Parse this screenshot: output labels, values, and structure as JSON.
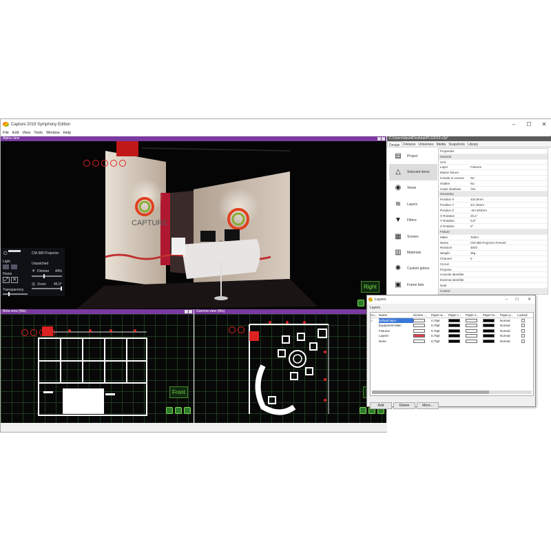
{
  "app_title": "Capture 2019 Symphony Edition",
  "menu": [
    "File",
    "Edit",
    "View",
    "Tools",
    "Window",
    "Help"
  ],
  "views": {
    "alpha": {
      "title": "Alpha view",
      "label": "Right"
    },
    "beta": {
      "title": "Beta view (Mix)",
      "label": "Front"
    },
    "gamma": {
      "title": "Gamma view (Mix)",
      "label": "T"
    }
  },
  "control_panel": {
    "fixture": "CM-380 Projector",
    "status": "Unpatched",
    "light": "Light",
    "home": "Home",
    "dimmer_label": "Dimmer",
    "dimmer_value": "44%",
    "zoom_label": "Zoom",
    "zoom_value": "45.0°",
    "transparency": "Transparency"
  },
  "right_panel": {
    "path": "C:\\Users\\david\\Desktop\\PLS2019.c2p*",
    "tabs": [
      "Design",
      "Fixtures",
      "Universes",
      "Media",
      "Snapshots",
      "Library"
    ],
    "sidebar": [
      {
        "label": "Project",
        "icon": "project-icon"
      },
      {
        "label": "Selected items",
        "icon": "selected-items-icon"
      },
      {
        "label": "Views",
        "icon": "eye-icon"
      },
      {
        "label": "Layers",
        "icon": "layers-icon"
      },
      {
        "label": "Filters",
        "icon": "filter-icon"
      },
      {
        "label": "Scenes",
        "icon": "clapper-icon"
      },
      {
        "label": "Materials",
        "icon": "materials-icon"
      },
      {
        "label": "Custom gobos",
        "icon": "gobo-icon"
      },
      {
        "label": "Frame lists",
        "icon": "frame-list-icon"
      }
    ],
    "properties_title": "Properties",
    "properties": [
      {
        "k": "General",
        "v": "",
        "sec": true
      },
      {
        "k": "Unit",
        "v": ""
      },
      {
        "k": "Layer",
        "v": "Fixtures"
      },
      {
        "k": "Motion fixture",
        "v": ""
      },
      {
        "k": "Include in scenes",
        "v": "No"
      },
      {
        "k": "Hidden",
        "v": "No"
      },
      {
        "k": "Casts shadows",
        "v": "Yes"
      },
      {
        "k": "Geometry",
        "v": "",
        "sec": true
      },
      {
        "k": "Position X",
        "v": "420,9mm"
      },
      {
        "k": "Position Y",
        "v": "4m 18mm"
      },
      {
        "k": "Position Z",
        "v": "-4m 503mm"
      },
      {
        "k": "X Rotation",
        "v": "20,1°"
      },
      {
        "k": "Y Rotation",
        "v": "0,0°"
      },
      {
        "k": "Z Rotation",
        "v": "0°"
      },
      {
        "k": "Fixture",
        "v": "",
        "sec": true
      },
      {
        "k": "Make",
        "v": "Telem"
      },
      {
        "k": "Name",
        "v": "CM-380 Projector Fresnel"
      },
      {
        "k": "Revision",
        "v": "3003"
      },
      {
        "k": "Weight",
        "v": "3kg"
      },
      {
        "k": "Channel",
        "v": "0"
      },
      {
        "k": "Circuit",
        "v": ""
      },
      {
        "k": "Purpose",
        "v": ""
      },
      {
        "k": "Console identifier",
        "v": ""
      },
      {
        "k": "External identifier",
        "v": ""
      },
      {
        "k": "Note",
        "v": ""
      },
      {
        "k": "Control",
        "v": "",
        "sec": true
      }
    ]
  },
  "layers_dialog": {
    "title": "Layers",
    "group": "Layers",
    "columns": [
      "Cu...",
      "Name",
      "Screen ...",
      "Paper w...",
      "Paper c...",
      "Paper s...",
      "Paper te...",
      "Paper p...",
      "Locked"
    ],
    "rows": [
      {
        "cur": "✓",
        "name": "Default layer",
        "screen": "#ffffff",
        "width": "0,75pt",
        "pc": "#000000",
        "ps": "#ffffff",
        "pt": "#000000",
        "pp": "Normal",
        "selected": true
      },
      {
        "cur": "",
        "name": "Equipment-Main",
        "screen": "#ffffff",
        "width": "0,75pt",
        "pc": "#000000",
        "ps": "#ffffff",
        "pt": "#000000",
        "pp": "Normal"
      },
      {
        "cur": "",
        "name": "Fixtures",
        "screen": "#ffffff",
        "width": "0,75pt",
        "pc": "#000000",
        "ps": "#ffffff",
        "pt": "#000000",
        "pp": "Normal"
      },
      {
        "cur": "",
        "name": "Layer0",
        "screen": "#e04050",
        "width": "0,75pt",
        "pc": "#000000",
        "ps": "#ffffff",
        "pt": "#000000",
        "pp": "Normal"
      },
      {
        "cur": "",
        "name": "None",
        "screen": "#ffffff",
        "width": "0,75pt",
        "pc": "#000000",
        "ps": "#ffffff",
        "pt": "#000000",
        "pp": "Normal"
      }
    ],
    "buttons": {
      "add": "Add",
      "delete": "Delete",
      "more": "More..."
    }
  },
  "colors": {
    "view_header": "#7a3aa0",
    "accent_green": "#7fdc4a",
    "fixture_red": "#d22222"
  }
}
